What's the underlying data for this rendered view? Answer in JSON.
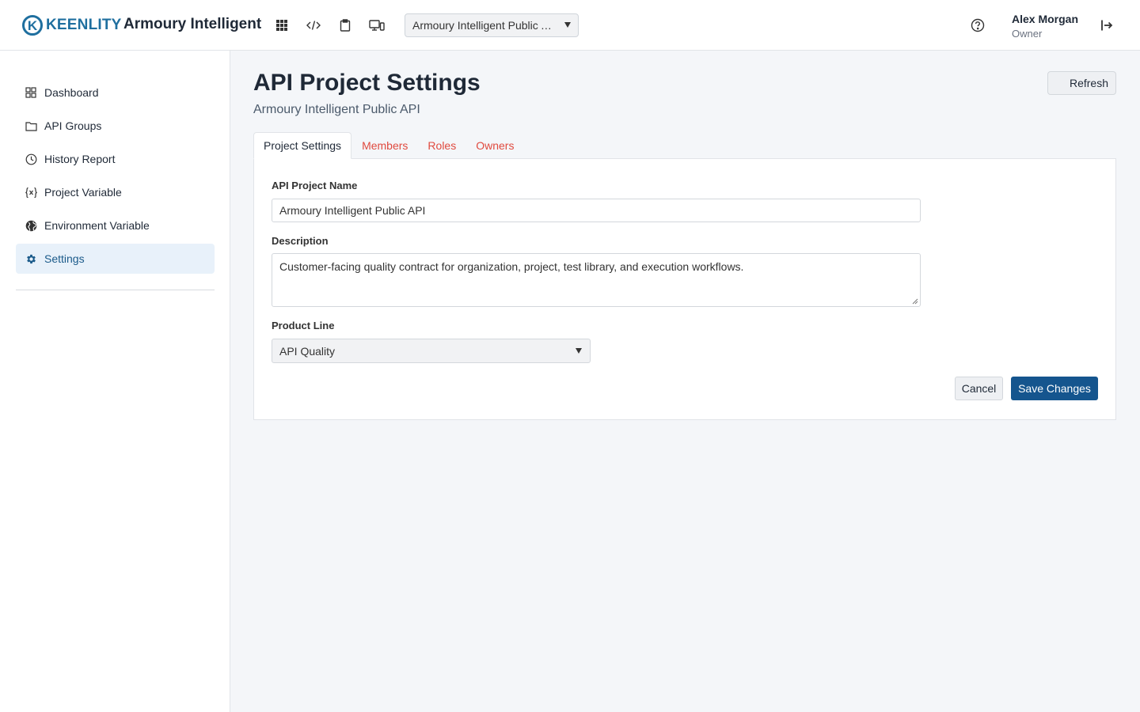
{
  "header": {
    "logo_letter": "K",
    "logo_text": "KEENLITY",
    "app_title": "Armoury Intelligent",
    "project_select": "Armoury Intelligent Public API",
    "user_name": "Alex Morgan",
    "user_role": "Owner",
    "icons": [
      "grid-icon",
      "code-icon",
      "clipboard-icon",
      "devices-icon",
      "help-icon",
      "logout-icon"
    ]
  },
  "sidebar": {
    "items": [
      {
        "label": "Dashboard",
        "icon": "dashboard-icon"
      },
      {
        "label": "API Groups",
        "icon": "folder-icon"
      },
      {
        "label": "History Report",
        "icon": "clock-icon"
      },
      {
        "label": "Project Variable",
        "icon": "variable-icon"
      },
      {
        "label": "Environment Variable",
        "icon": "globe-icon"
      },
      {
        "label": "Settings",
        "icon": "gear-icon",
        "active": true
      }
    ]
  },
  "page": {
    "title": "API Project Settings",
    "subtitle": "Armoury Intelligent Public API",
    "refresh_label": "Refresh"
  },
  "tabs": [
    {
      "label": "Project Settings",
      "active": true
    },
    {
      "label": "Members"
    },
    {
      "label": "Roles"
    },
    {
      "label": "Owners"
    }
  ],
  "form": {
    "name_label": "API Project Name",
    "name_value": "Armoury Intelligent Public API",
    "description_label": "Description",
    "description_value": "Customer-facing quality contract for organization, project, test library, and execution workflows.",
    "product_line_label": "Product Line",
    "product_line_value": "API Quality",
    "cancel_label": "Cancel",
    "save_label": "Save Changes"
  },
  "colors": {
    "accent": "#15558e",
    "brand": "#1f6f9f",
    "tab_link": "#e04a3f",
    "active_nav_bg": "#e8f1fa"
  }
}
